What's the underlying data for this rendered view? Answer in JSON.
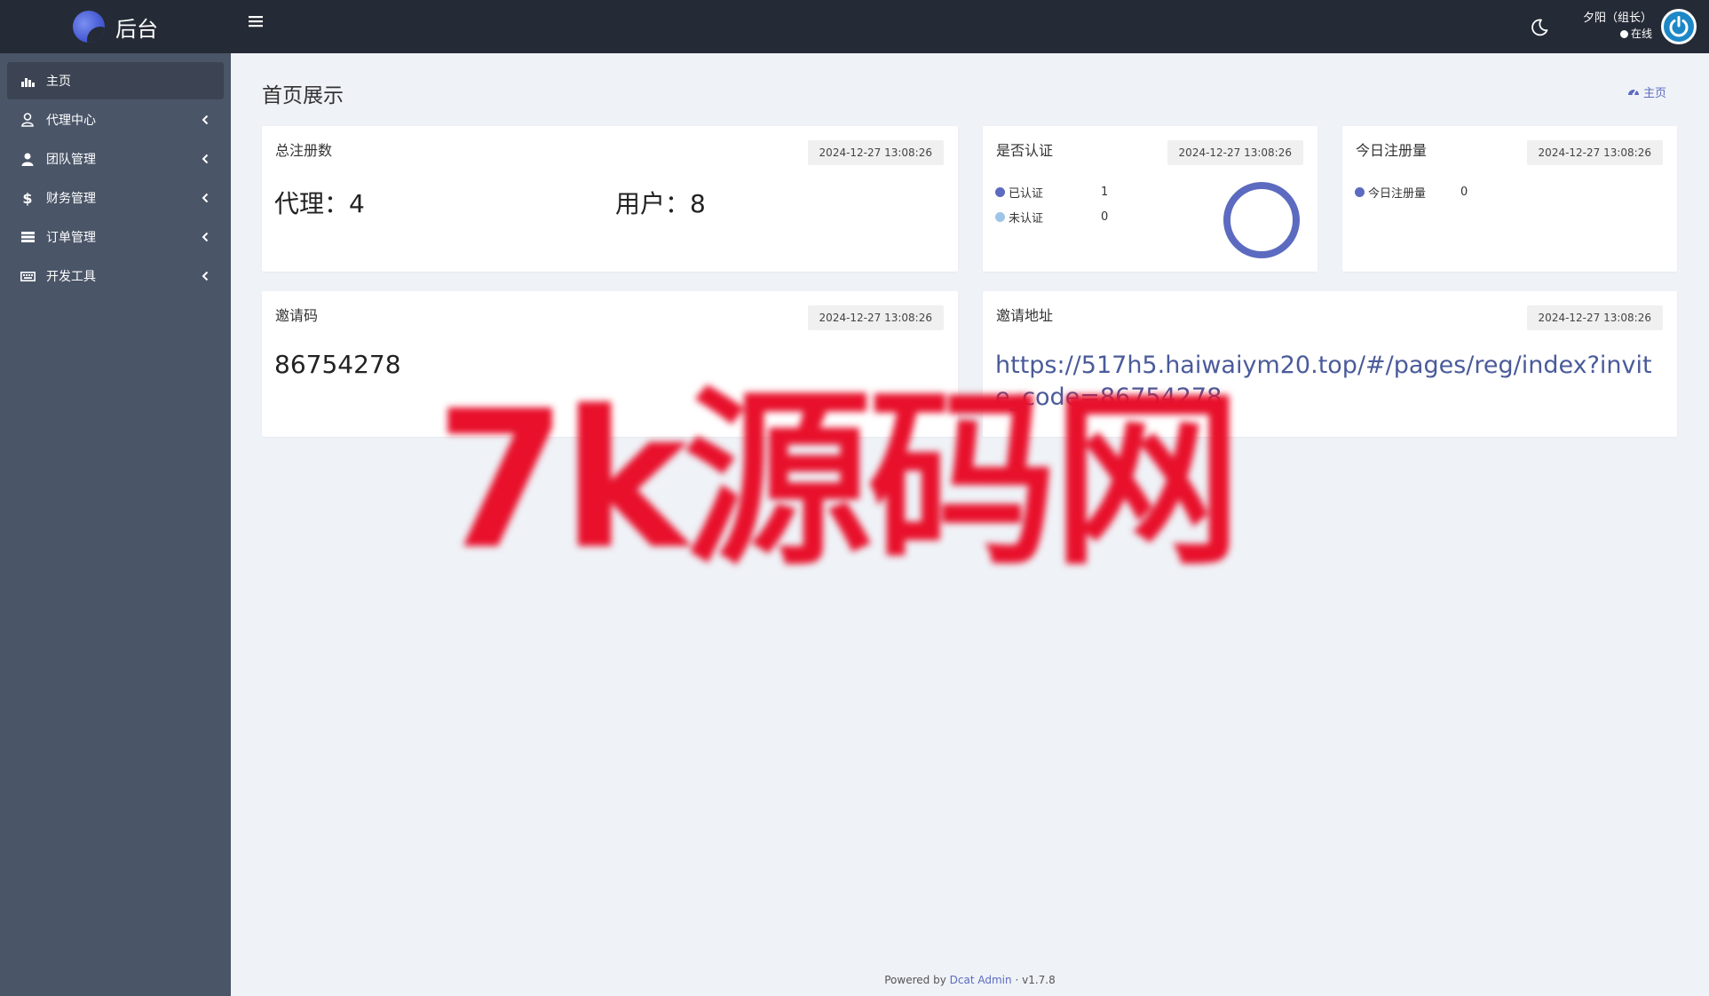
{
  "brand": {
    "title": "后台"
  },
  "sidebar": {
    "items": [
      {
        "label": "主页",
        "icon": "bar-chart-icon",
        "active": true
      },
      {
        "label": "代理中心",
        "icon": "user-icon"
      },
      {
        "label": "团队管理",
        "icon": "team-icon"
      },
      {
        "label": "财务管理",
        "icon": "dollar-icon"
      },
      {
        "label": "订单管理",
        "icon": "list-icon"
      },
      {
        "label": "开发工具",
        "icon": "keyboard-icon"
      }
    ]
  },
  "header": {
    "user_name": "夕阳（组长）",
    "user_status": "在线"
  },
  "page": {
    "title": "首页展示",
    "breadcrumb": "主页"
  },
  "cards": {
    "total_registrations": {
      "title": "总注册数",
      "time": "2024-12-27 13:08:26",
      "agent_text": "代理：4",
      "user_text": "用户：8"
    },
    "verified": {
      "title": "是否认证",
      "time": "2024-12-27 13:08:26",
      "legend": [
        {
          "label": "已认证",
          "value": "1",
          "color": "#5c6bc0"
        },
        {
          "label": "未认证",
          "value": "0",
          "color": "#9ec5e8"
        }
      ]
    },
    "today_registrations": {
      "title": "今日注册量",
      "time": "2024-12-27 13:08:26",
      "legend": [
        {
          "label": "今日注册量",
          "value": "0",
          "color": "#5c6bc0"
        }
      ]
    },
    "invite_code": {
      "title": "邀请码",
      "time": "2024-12-27 13:08:26",
      "code": "86754278"
    },
    "invite_url": {
      "title": "邀请地址",
      "time": "2024-12-27 13:08:26",
      "url": "https://517h5.haiwaiym20.top/#/pages/reg/index?invite_code=86754278"
    }
  },
  "footer": {
    "prefix": "Powered by",
    "link": "Dcat Admin",
    "separator": "·",
    "version": "v1.7.8"
  },
  "watermark": {
    "text": "7k源码网"
  },
  "colors": {
    "sidebar": "#4a5568",
    "header": "#252b36",
    "accent": "#5c6bc0",
    "background": "#eff2f7"
  }
}
